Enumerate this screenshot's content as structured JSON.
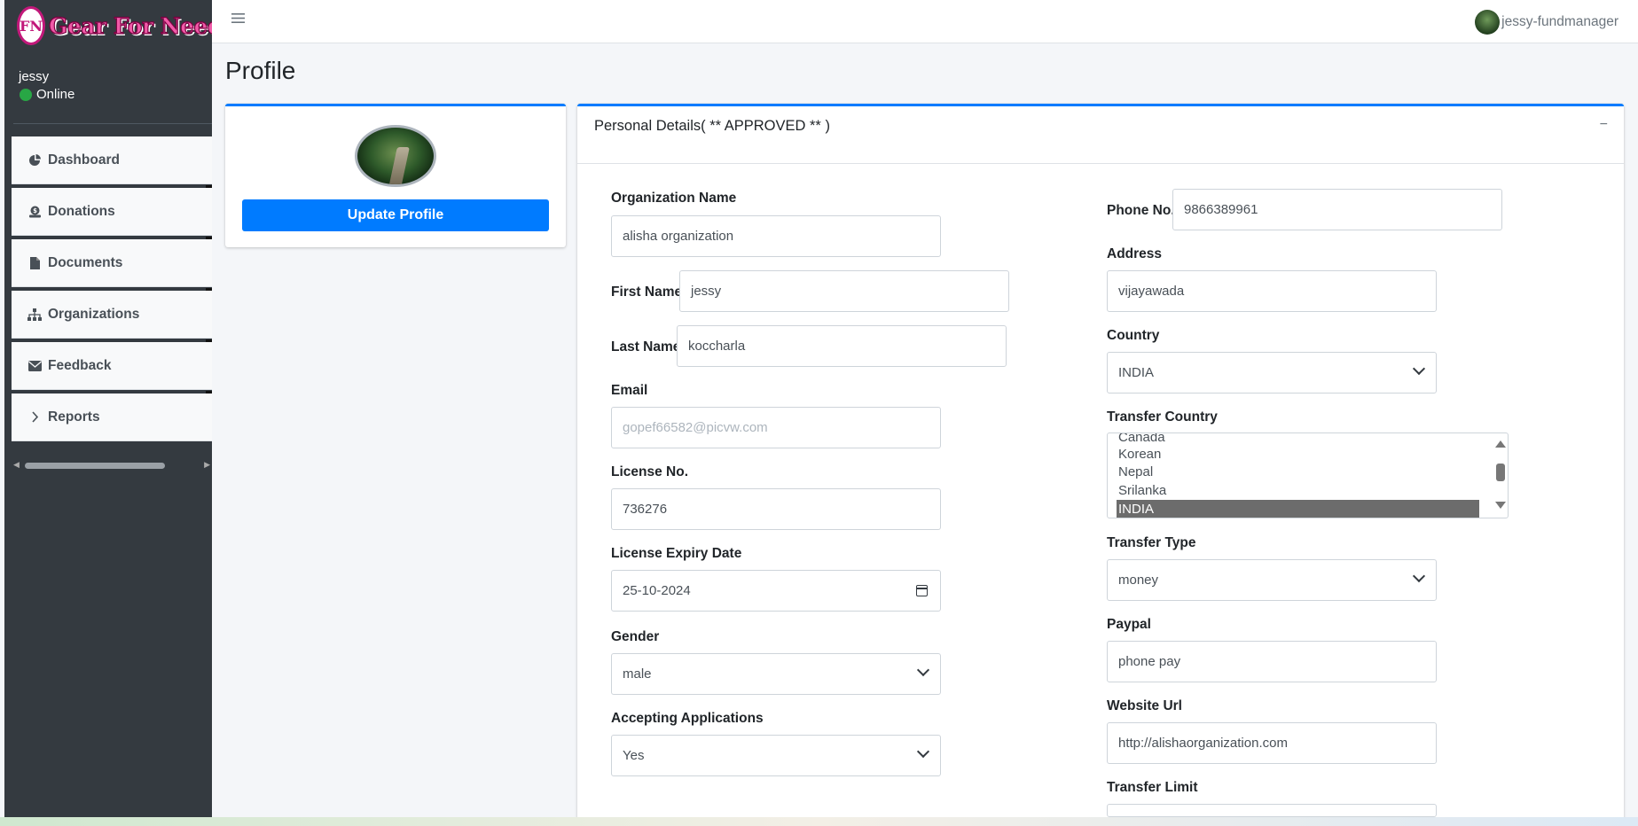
{
  "brand": {
    "logo_text": "FN",
    "name": "Gear For Need"
  },
  "sidebar": {
    "user_name": "jessy",
    "status": "Online",
    "items": [
      {
        "label": "Dashboard",
        "icon": "chart-pie-icon"
      },
      {
        "label": "Donations",
        "icon": "donate-icon"
      },
      {
        "label": "Documents",
        "icon": "file-icon"
      },
      {
        "label": "Organizations",
        "icon": "sitemap-icon"
      },
      {
        "label": "Feedback",
        "icon": "envelope-icon"
      },
      {
        "label": "Reports",
        "icon": "chevron-right-icon"
      }
    ]
  },
  "topbar": {
    "menu_icon": "hamburger-icon",
    "user": "jessy-fundmanager"
  },
  "page": {
    "title": "Profile"
  },
  "profile_card": {
    "button": "Update Profile"
  },
  "details": {
    "header": "Personal Details( ** APPROVED ** )",
    "collapse_symbol": "−",
    "org_name": {
      "label": "Organization Name",
      "value": "alisha organization"
    },
    "first_name": {
      "label": "First Name",
      "value": "jessy"
    },
    "last_name": {
      "label": "Last Name",
      "value": "koccharla"
    },
    "email": {
      "label": "Email",
      "value": "gopef66582@picvw.com"
    },
    "license": {
      "label": "License No.",
      "value": "736276"
    },
    "license_expiry": {
      "label": "License Expiry Date",
      "value": "25-10-2024"
    },
    "gender": {
      "label": "Gender",
      "value": "male"
    },
    "accepting": {
      "label": "Accepting Applications",
      "value": "Yes"
    },
    "phone": {
      "label": "Phone No.",
      "value": "9866389961"
    },
    "address": {
      "label": "Address",
      "value": "vijayawada"
    },
    "country": {
      "label": "Country",
      "value": "INDIA"
    },
    "transfer_country": {
      "label": "Transfer Country",
      "options": [
        "Canada",
        "Korean",
        "Nepal",
        "Srilanka",
        "INDIA"
      ],
      "selected": "INDIA"
    },
    "transfer_type": {
      "label": "Transfer Type",
      "value": "money"
    },
    "paypal": {
      "label": "Paypal",
      "value": "phone pay"
    },
    "website": {
      "label": "Website Url",
      "value": "http://alishaorganization.com"
    },
    "transfer_limit": {
      "label": "Transfer Limit",
      "value": ""
    }
  },
  "colors": {
    "primary": "#007bff",
    "sidebar": "#343a40",
    "online": "#28a745"
  }
}
